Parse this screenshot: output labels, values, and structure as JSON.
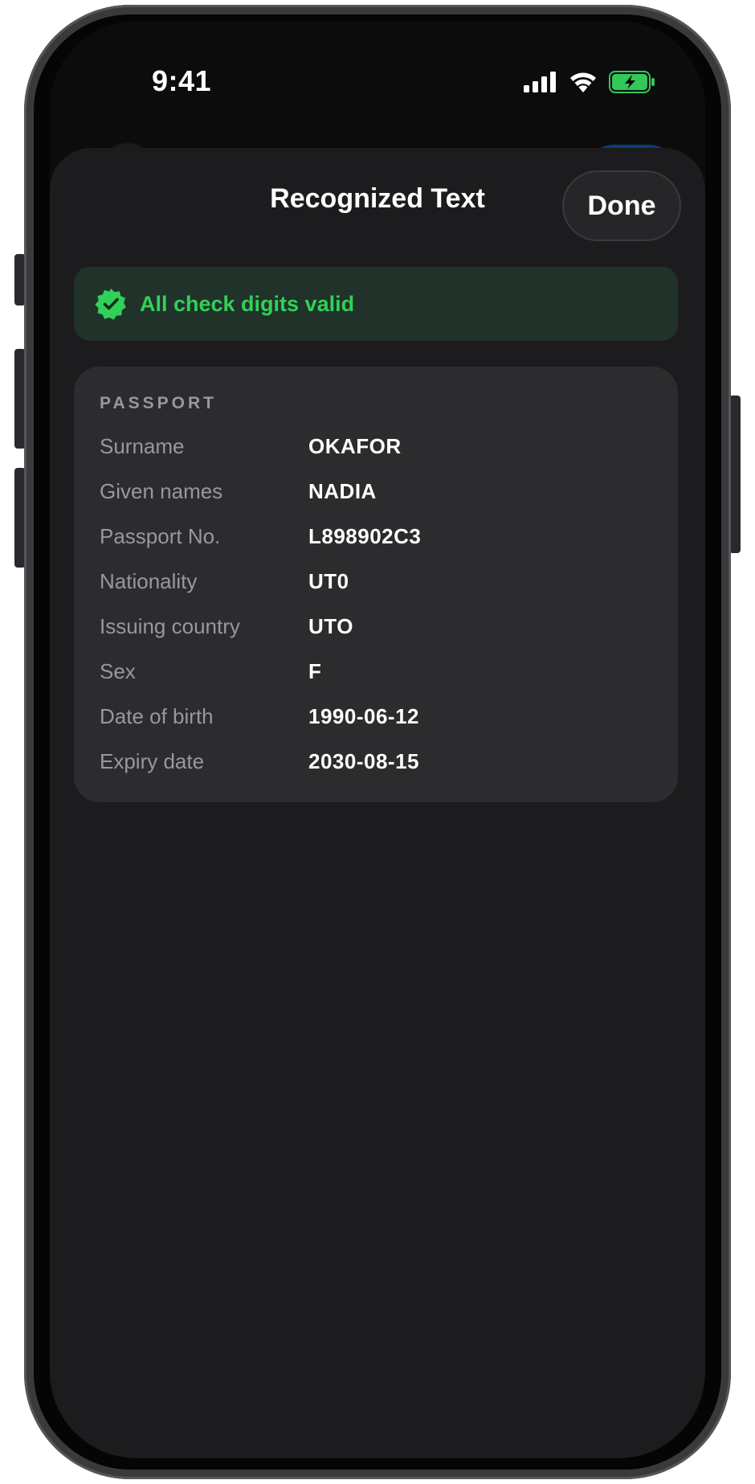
{
  "status_bar": {
    "time": "9:41"
  },
  "sheet": {
    "title": "Recognized Text",
    "done_label": "Done"
  },
  "validity": {
    "message": "All check digits valid",
    "icon": "verified-badge-icon",
    "color": "#30d158"
  },
  "passport": {
    "heading": "PASSPORT",
    "fields": [
      {
        "label": "Surname",
        "value": "OKAFOR"
      },
      {
        "label": "Given names",
        "value": "NADIA"
      },
      {
        "label": "Passport No.",
        "value": "L898902C3"
      },
      {
        "label": "Nationality",
        "value": "UT0"
      },
      {
        "label": "Issuing country",
        "value": "UTO"
      },
      {
        "label": "Sex",
        "value": "F"
      },
      {
        "label": "Date of birth",
        "value": "1990-06-12"
      },
      {
        "label": "Expiry date",
        "value": "2030-08-15"
      }
    ]
  },
  "colors": {
    "sheet_background": "#1c1c1e",
    "card_background": "#2c2c2e",
    "banner_background": "#20322a",
    "accent_green": "#30d158",
    "battery_green": "#34c759"
  }
}
